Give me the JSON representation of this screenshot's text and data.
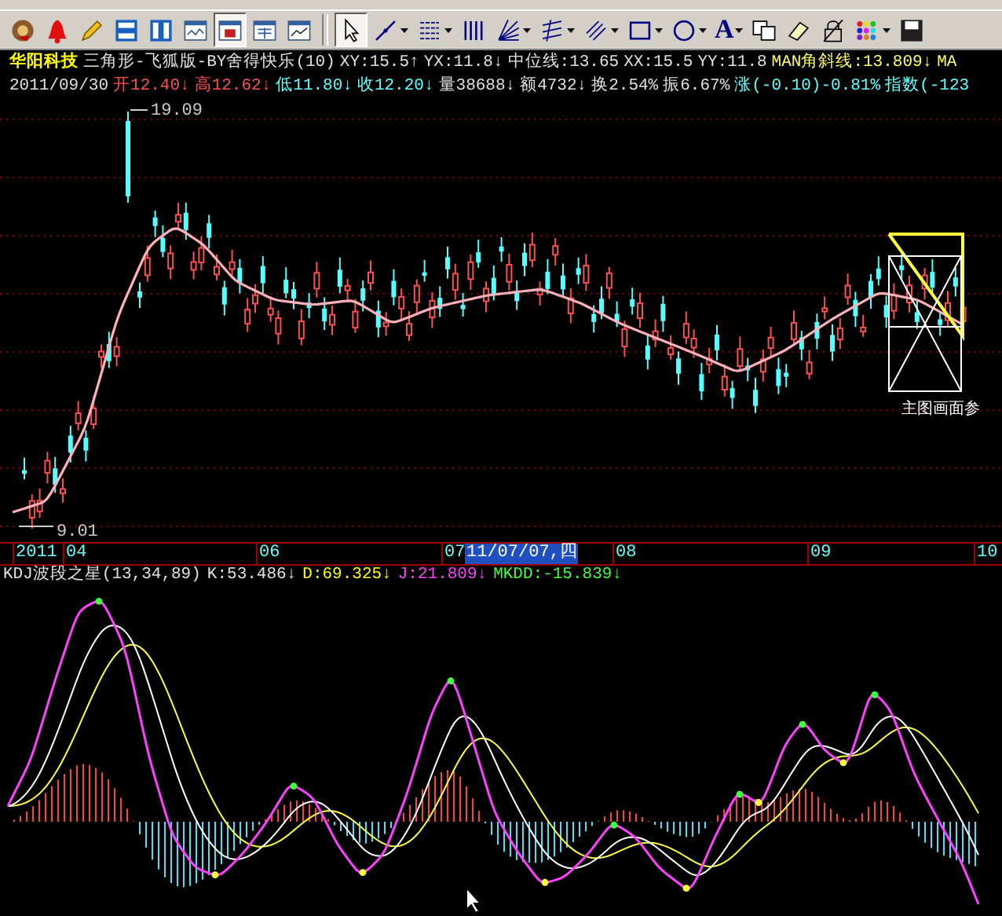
{
  "toolbar": {
    "views": [
      {
        "kind": "coin",
        "selected": false
      },
      {
        "kind": "bell",
        "selected": false
      },
      {
        "kind": "pencil",
        "selected": false
      },
      {
        "kind": "rows",
        "selected": false
      },
      {
        "kind": "cols",
        "selected": false
      },
      {
        "kind": "win",
        "selected": false
      },
      {
        "kind": "winred",
        "selected": true
      },
      {
        "kind": "wingrid",
        "selected": false
      },
      {
        "kind": "winline",
        "selected": false
      }
    ],
    "tools": [
      {
        "kind": "cursor",
        "selected": true
      },
      {
        "kind": "line",
        "selected": false,
        "menu": true
      },
      {
        "kind": "lines",
        "selected": false,
        "menu": true
      },
      {
        "kind": "bars",
        "selected": false
      },
      {
        "kind": "fan",
        "selected": false,
        "menu": true
      },
      {
        "kind": "parallel",
        "selected": false,
        "menu": true
      },
      {
        "kind": "hatch",
        "selected": false,
        "menu": true
      },
      {
        "kind": "rect",
        "selected": false,
        "menu": true
      },
      {
        "kind": "ellipse",
        "selected": false,
        "menu": true
      },
      {
        "kind": "text",
        "label": "A",
        "selected": false,
        "menu": true
      },
      {
        "kind": "copy",
        "selected": false
      },
      {
        "kind": "eraser",
        "selected": false
      },
      {
        "kind": "lock",
        "selected": false
      },
      {
        "kind": "palette",
        "selected": false,
        "menu": true
      },
      {
        "kind": "save",
        "selected": false
      }
    ]
  },
  "quote": {
    "lines": [
      [
        {
          "text": "华阳科技",
          "color": "#ffff00"
        },
        {
          "text": "三角形-飞狐版-BY舍得快乐(10)",
          "color": "#e0e0e0"
        },
        {
          "text": "XY:15.5↑",
          "color": "#e0e0e0"
        },
        {
          "text": "YX:11.8↓",
          "color": "#e0e0e0"
        },
        {
          "text": "中位线:13.65",
          "color": "#e0e0e0"
        },
        {
          "text": "XX:15.5",
          "color": "#e0e0e0"
        },
        {
          "text": "YY:11.8",
          "color": "#e0e0e0"
        },
        {
          "text": "MAN角斜线:13.809↓",
          "color": "#ffff66"
        },
        {
          "text": "MA",
          "color": "#ffff66"
        }
      ],
      [
        {
          "text": "2011/09/30",
          "color": "#e0e0e0"
        },
        {
          "text": "开12.40↓",
          "color": "#ff5050"
        },
        {
          "text": "高12.62↓",
          "color": "#ff5050"
        },
        {
          "text": "低11.80↓",
          "color": "#60ffff"
        },
        {
          "text": "收12.20↓",
          "color": "#60ffff"
        },
        {
          "text": "量38688↓",
          "color": "#e0e0e0"
        },
        {
          "text": "额4732↓",
          "color": "#e0e0e0"
        },
        {
          "text": "换2.54%",
          "color": "#e0e0e0"
        },
        {
          "text": "振6.67%",
          "color": "#e0e0e0"
        },
        {
          "text": "涨(-0.10)-0.81%",
          "color": "#60ffff"
        },
        {
          "text": "指数(-123",
          "color": "#60ffff"
        }
      ]
    ]
  },
  "price_chart": {
    "high_label": "19.09",
    "low_label": "9.01",
    "note": "主图画面参"
  },
  "time_axis": {
    "labels": [
      {
        "text": "2011",
        "selected": false
      },
      {
        "text": "04",
        "selected": false
      },
      {
        "text": "06",
        "selected": false
      },
      {
        "text": "07",
        "selected": false
      },
      {
        "text": "11/07/07,四",
        "selected": true
      },
      {
        "text": "08",
        "selected": false
      },
      {
        "text": "09",
        "selected": false
      },
      {
        "text": "10",
        "selected": false
      }
    ]
  },
  "indicator": {
    "items": [
      {
        "text": "KDJ波段之星(13,34,89)",
        "color": "#e0e0e0"
      },
      {
        "text": "K:53.486↓",
        "color": "#e0e0e0"
      },
      {
        "text": "D:69.325↓",
        "color": "#ffff00"
      },
      {
        "text": "J:21.809↓",
        "color": "#ff40ff"
      },
      {
        "text": "MKDD:-15.839↓",
        "color": "#40ff40"
      }
    ]
  }
}
